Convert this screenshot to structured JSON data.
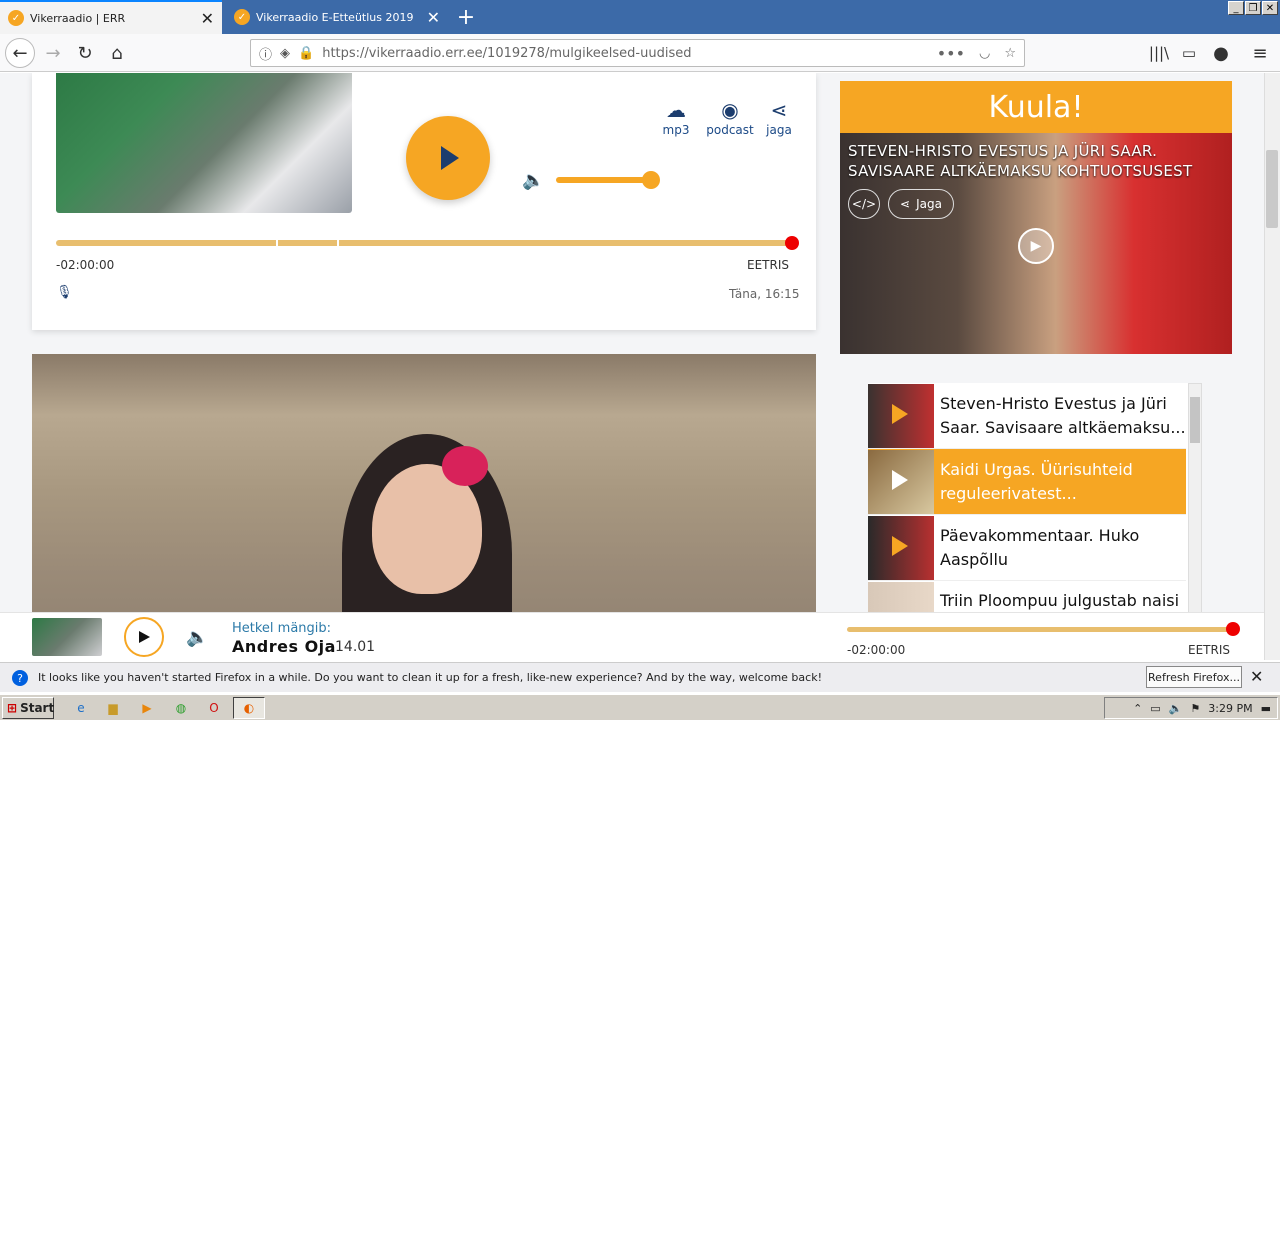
{
  "browser": {
    "tabs": [
      {
        "title": "Vikerraadio | ERR",
        "active": true
      },
      {
        "title": "Vikerraadio E-Etteütlus 2019",
        "active": false
      }
    ],
    "url": "https://vikerraadio.err.ee/1019278/mulgikeelsed-uudised",
    "new_tab": "+"
  },
  "player": {
    "tools": [
      {
        "label": "mp3",
        "icon": "cloud-download-icon"
      },
      {
        "label": "podcast",
        "icon": "podcast-icon"
      },
      {
        "label": "jaga",
        "icon": "share-icon"
      }
    ],
    "time_left": "-02:00:00",
    "live": "EETRIS",
    "date": "Täna, 16:15",
    "progress_fraction": 1.0,
    "volume_fraction": 1.0
  },
  "sidebar": {
    "heading": "Kuula!",
    "feature": {
      "title": "Steven-Hristo Evestus ja Jüri Saar. Savisaare altkäemaksu kohtuotsusest",
      "share_label": "Jaga"
    },
    "playlist": [
      {
        "title": "Steven-Hristo Evestus ja Jüri Saar. Savisaare altkäemaksu...",
        "active": false
      },
      {
        "title": "Kaidi Urgas. Üürisuhteid reguleerivatest...",
        "active": true
      },
      {
        "title": "Päevakommentaar. Huko Aaspõllu",
        "active": false
      },
      {
        "title": "Triin Ploompuu julgustab naisi",
        "active": false
      }
    ]
  },
  "bottom_player": {
    "now_playing_label": "Hetkel mängib:",
    "artist": "Andres Oja",
    "time": "14.01",
    "time_left": "-02:00:00",
    "live": "EETRIS"
  },
  "notification": {
    "text": "It looks like you haven't started Firefox in a while. Do you want to clean it up for a fresh, like-new experience? And by the way, welcome back!",
    "button": "Refresh Firefox..."
  },
  "taskbar": {
    "start": "Start",
    "clock": "3:29 PM"
  },
  "colors": {
    "accent": "#f6a623",
    "live_dot": "#ee0000",
    "brand_blue": "#1c3d6e"
  }
}
